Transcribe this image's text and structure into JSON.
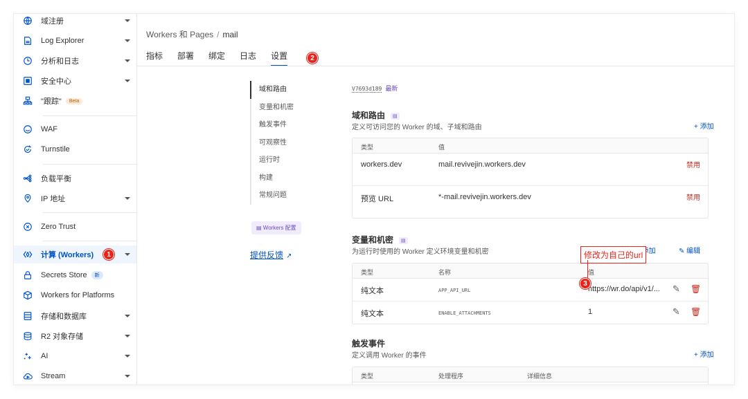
{
  "sidebar": {
    "items": [
      {
        "label": "域注册",
        "icon": "globe-icon",
        "chevron": true
      },
      {
        "label": "Log Explorer",
        "icon": "document-icon",
        "chevron": true
      },
      {
        "label": "分析和日志",
        "icon": "clock-icon",
        "chevron": true
      },
      {
        "label": "安全中心",
        "icon": "shield-square-icon",
        "chevron": true
      },
      {
        "label": "\"跟踪\"",
        "icon": "sitemap-icon",
        "badge": "Beta"
      },
      {
        "label": "WAF",
        "icon": "waf-shield-icon"
      },
      {
        "label": "Turnstile",
        "icon": "refresh-icon"
      },
      {
        "label": "负载平衡",
        "icon": "load-balancer-icon"
      },
      {
        "label": "IP 地址",
        "icon": "location-pin-icon",
        "chevron": true
      },
      {
        "label": "Zero Trust",
        "icon": "zero-trust-icon"
      },
      {
        "label": "计算 (Workers)",
        "icon": "workers-icon",
        "chevron": true,
        "active": true,
        "step": "1"
      },
      {
        "label": "Secrets Store",
        "icon": "lock-icon",
        "badge": "新"
      },
      {
        "label": "Workers for Platforms",
        "icon": "cube-icon"
      },
      {
        "label": "存储和数据库",
        "icon": "database-icon",
        "chevron": true
      },
      {
        "label": "R2 对象存储",
        "icon": "storage-icon",
        "chevron": true
      },
      {
        "label": "AI",
        "icon": "sparkle-icon",
        "chevron": true
      },
      {
        "label": "Stream",
        "icon": "cloud-icon",
        "chevron": true
      }
    ]
  },
  "header": {
    "breadcrumb_parent": "Workers 和 Pages",
    "breadcrumb_sep": "/",
    "breadcrumb_current": "mail"
  },
  "tabs": [
    {
      "label": "指标"
    },
    {
      "label": "部署"
    },
    {
      "label": "绑定"
    },
    {
      "label": "日志"
    },
    {
      "label": "设置",
      "active": true
    }
  ],
  "tab_step": "2",
  "subnav": {
    "items": [
      "域和路由",
      "变量和机密",
      "触发事件",
      "可观察性",
      "运行时",
      "构建",
      "常规问题"
    ],
    "workers_config": "Workers 配置",
    "feedback": "提供反馈"
  },
  "version": {
    "id": "V7693d189",
    "latest": "最新"
  },
  "domains": {
    "title": "域和路由",
    "desc": "定义可访问您的 Worker 的域、子域和路由",
    "add": "+ 添加",
    "headers": [
      "类型",
      "值"
    ],
    "rows": [
      {
        "type": "workers.dev",
        "value": "mail.revivejin.workers.dev",
        "action": "禁用"
      },
      {
        "type": "预览 URL",
        "value": "*-mail.revivejin.workers.dev",
        "action": "禁用"
      }
    ]
  },
  "variables": {
    "title": "变量和机密",
    "desc": "为运行时使用的 Worker 定义环境变量和机密",
    "add": "+ 添加",
    "edit": "编辑",
    "headers": [
      "类型",
      "名称",
      "值"
    ],
    "rows": [
      {
        "type": "纯文本",
        "name": "APP_API_URL",
        "value": "https://wr.do/api/v1/..."
      },
      {
        "type": "纯文本",
        "name": "ENABLE_ATTACHMENTS",
        "value": "1"
      }
    ]
  },
  "triggers": {
    "title": "触发事件",
    "desc": "定义调用 Worker 的事件",
    "add": "+ 添加",
    "headers": [
      "类型",
      "处理程序",
      "详细信息"
    ]
  },
  "annotation": {
    "text": "修改为自己的url",
    "step": "3"
  },
  "colors": {
    "accent": "#0051c3",
    "danger": "#c4271d",
    "marker": "#e8231b",
    "purple": "#6b4bbd"
  }
}
